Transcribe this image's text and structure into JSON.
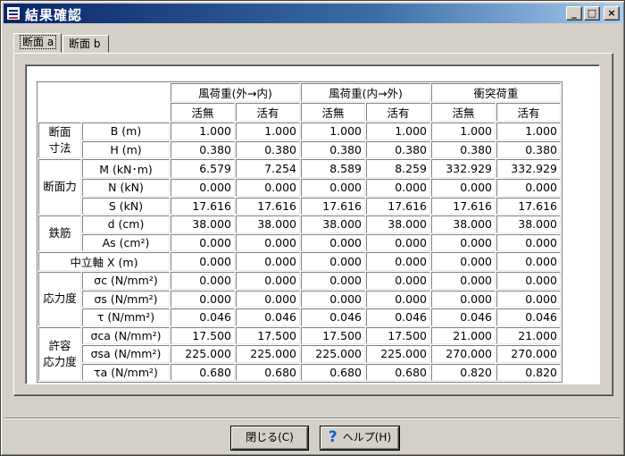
{
  "window": {
    "title": "結果確認",
    "minimize": "_",
    "maximize": "□",
    "close": "×"
  },
  "tabs": [
    {
      "label": "断面 a",
      "active": true
    },
    {
      "label": "断面 b",
      "active": false
    }
  ],
  "table": {
    "groups": [
      "風荷重(外→内)",
      "風荷重(内→外)",
      "衝突荷重"
    ],
    "subheaders": [
      "活無",
      "活有",
      "活無",
      "活有",
      "活無",
      "活有"
    ],
    "sections": {
      "dimensions": "断面\n寸法",
      "force": "断面力",
      "rebar": "鉄筋",
      "stress": "応力度",
      "allowable": "許容\n応力度"
    },
    "rows": [
      {
        "label": "B (m)",
        "values": [
          "1.000",
          "1.000",
          "1.000",
          "1.000",
          "1.000",
          "1.000"
        ]
      },
      {
        "label": "H (m)",
        "values": [
          "0.380",
          "0.380",
          "0.380",
          "0.380",
          "0.380",
          "0.380"
        ]
      },
      {
        "label": "M (kN･m)",
        "values": [
          "6.579",
          "7.254",
          "8.589",
          "8.259",
          "332.929",
          "332.929"
        ]
      },
      {
        "label": "N (kN)",
        "values": [
          "0.000",
          "0.000",
          "0.000",
          "0.000",
          "0.000",
          "0.000"
        ]
      },
      {
        "label": "S (kN)",
        "values": [
          "17.616",
          "17.616",
          "17.616",
          "17.616",
          "17.616",
          "17.616"
        ]
      },
      {
        "label": "d (cm)",
        "values": [
          "38.000",
          "38.000",
          "38.000",
          "38.000",
          "38.000",
          "38.000"
        ]
      },
      {
        "label": "As (cm²)",
        "values": [
          "0.000",
          "0.000",
          "0.000",
          "0.000",
          "0.000",
          "0.000"
        ]
      },
      {
        "label": "中立軸 X (m)",
        "values": [
          "0.000",
          "0.000",
          "0.000",
          "0.000",
          "0.000",
          "0.000"
        ]
      },
      {
        "label": "σc (N/mm²)",
        "values": [
          "0.000",
          "0.000",
          "0.000",
          "0.000",
          "0.000",
          "0.000"
        ]
      },
      {
        "label": "σs (N/mm²)",
        "values": [
          "0.000",
          "0.000",
          "0.000",
          "0.000",
          "0.000",
          "0.000"
        ]
      },
      {
        "label": "τ (N/mm²)",
        "values": [
          "0.046",
          "0.046",
          "0.046",
          "0.046",
          "0.046",
          "0.046"
        ]
      },
      {
        "label": "σca (N/mm²)",
        "values": [
          "17.500",
          "17.500",
          "17.500",
          "17.500",
          "21.000",
          "21.000"
        ]
      },
      {
        "label": "σsa (N/mm²)",
        "values": [
          "225.000",
          "225.000",
          "225.000",
          "225.000",
          "270.000",
          "270.000"
        ]
      },
      {
        "label": "τa (N/mm²)",
        "values": [
          "0.680",
          "0.680",
          "0.680",
          "0.680",
          "0.820",
          "0.820"
        ]
      }
    ]
  },
  "buttons": {
    "close_label": "閉じる(C)",
    "help_label": "ヘルプ(H)",
    "help_icon": "question-icon"
  }
}
